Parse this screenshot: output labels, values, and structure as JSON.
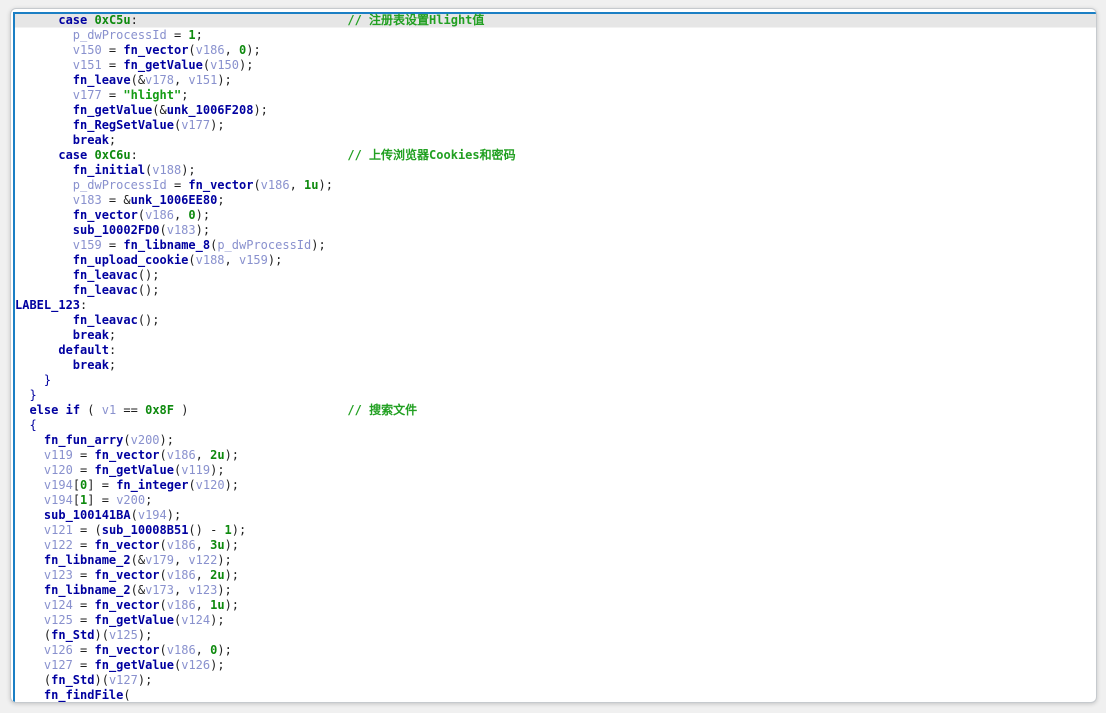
{
  "panel": {
    "type": "pseudocode-decompiler-view"
  },
  "colors": {
    "accent_blue": "#1B7FC4",
    "band_gray": "#E6E6E6",
    "keyword_navy": "#0000A0",
    "variable_periwinkle": "#8991CE",
    "number_green": "#0E8A0E",
    "string_green": "#149C14",
    "comment_green": "#22A022",
    "punct_black": "#1E1E1E",
    "panel_border": "#C6CACE",
    "page_bg": "#F0F0F0"
  },
  "code": {
    "comment_prefix": "// ",
    "comment_column": 46,
    "lines": [
      {
        "highlight": true,
        "comment": "注册表设置Hlight值",
        "segments": [
          [
            "p",
            "      "
          ],
          [
            "kw",
            "case"
          ],
          [
            "p",
            " "
          ],
          [
            "num",
            "0xC5u"
          ],
          [
            "p",
            ":"
          ]
        ]
      },
      {
        "segments": [
          [
            "p",
            "        "
          ],
          [
            "var",
            "p_dwProcessId"
          ],
          [
            "p",
            " = "
          ],
          [
            "num",
            "1"
          ],
          [
            "p",
            ";"
          ]
        ]
      },
      {
        "segments": [
          [
            "p",
            "        "
          ],
          [
            "var",
            "v150"
          ],
          [
            "p",
            " = "
          ],
          [
            "fn",
            "fn_vector"
          ],
          [
            "p",
            "("
          ],
          [
            "var",
            "v186"
          ],
          [
            "p",
            ", "
          ],
          [
            "num",
            "0"
          ],
          [
            "p",
            ");"
          ]
        ]
      },
      {
        "segments": [
          [
            "p",
            "        "
          ],
          [
            "var",
            "v151"
          ],
          [
            "p",
            " = "
          ],
          [
            "fn",
            "fn_getValue"
          ],
          [
            "p",
            "("
          ],
          [
            "var",
            "v150"
          ],
          [
            "p",
            ");"
          ]
        ]
      },
      {
        "segments": [
          [
            "p",
            "        "
          ],
          [
            "fn",
            "fn_leave"
          ],
          [
            "p",
            "(&"
          ],
          [
            "var",
            "v178"
          ],
          [
            "p",
            ", "
          ],
          [
            "var",
            "v151"
          ],
          [
            "p",
            ");"
          ]
        ]
      },
      {
        "segments": [
          [
            "p",
            "        "
          ],
          [
            "var",
            "v177"
          ],
          [
            "p",
            " = "
          ],
          [
            "str",
            "\"hlight\""
          ],
          [
            "p",
            ";"
          ]
        ]
      },
      {
        "segments": [
          [
            "p",
            "        "
          ],
          [
            "fn",
            "fn_getValue"
          ],
          [
            "p",
            "(&"
          ],
          [
            "fn",
            "unk_1006F208"
          ],
          [
            "p",
            ");"
          ]
        ]
      },
      {
        "segments": [
          [
            "p",
            "        "
          ],
          [
            "fn",
            "fn_RegSetValue"
          ],
          [
            "p",
            "("
          ],
          [
            "var",
            "v177"
          ],
          [
            "p",
            ");"
          ]
        ]
      },
      {
        "segments": [
          [
            "p",
            "        "
          ],
          [
            "kw",
            "break"
          ],
          [
            "p",
            ";"
          ]
        ]
      },
      {
        "comment": "上传浏览器Cookies和密码",
        "segments": [
          [
            "p",
            "      "
          ],
          [
            "kw",
            "case"
          ],
          [
            "p",
            " "
          ],
          [
            "num",
            "0xC6u"
          ],
          [
            "p",
            ":"
          ]
        ]
      },
      {
        "segments": [
          [
            "p",
            "        "
          ],
          [
            "fn",
            "fn_initial"
          ],
          [
            "p",
            "("
          ],
          [
            "var",
            "v188"
          ],
          [
            "p",
            ");"
          ]
        ]
      },
      {
        "segments": [
          [
            "p",
            "        "
          ],
          [
            "var",
            "p_dwProcessId"
          ],
          [
            "p",
            " = "
          ],
          [
            "fn",
            "fn_vector"
          ],
          [
            "p",
            "("
          ],
          [
            "var",
            "v186"
          ],
          [
            "p",
            ", "
          ],
          [
            "num",
            "1u"
          ],
          [
            "p",
            ");"
          ]
        ]
      },
      {
        "segments": [
          [
            "p",
            "        "
          ],
          [
            "var",
            "v183"
          ],
          [
            "p",
            " = &"
          ],
          [
            "fn",
            "unk_1006EE80"
          ],
          [
            "p",
            ";"
          ]
        ]
      },
      {
        "segments": [
          [
            "p",
            "        "
          ],
          [
            "fn",
            "fn_vector"
          ],
          [
            "p",
            "("
          ],
          [
            "var",
            "v186"
          ],
          [
            "p",
            ", "
          ],
          [
            "num",
            "0"
          ],
          [
            "p",
            ");"
          ]
        ]
      },
      {
        "segments": [
          [
            "p",
            "        "
          ],
          [
            "fn",
            "sub_10002FD0"
          ],
          [
            "p",
            "("
          ],
          [
            "var",
            "v183"
          ],
          [
            "p",
            ");"
          ]
        ]
      },
      {
        "segments": [
          [
            "p",
            "        "
          ],
          [
            "var",
            "v159"
          ],
          [
            "p",
            " = "
          ],
          [
            "fn",
            "fn_libname_8"
          ],
          [
            "p",
            "("
          ],
          [
            "var",
            "p_dwProcessId"
          ],
          [
            "p",
            ");"
          ]
        ]
      },
      {
        "segments": [
          [
            "p",
            "        "
          ],
          [
            "fn",
            "fn_upload_cookie"
          ],
          [
            "p",
            "("
          ],
          [
            "var",
            "v188"
          ],
          [
            "p",
            ", "
          ],
          [
            "var",
            "v159"
          ],
          [
            "p",
            ");"
          ]
        ]
      },
      {
        "segments": [
          [
            "p",
            "        "
          ],
          [
            "fn",
            "fn_leavac"
          ],
          [
            "p",
            "();"
          ]
        ]
      },
      {
        "segments": [
          [
            "p",
            "        "
          ],
          [
            "fn",
            "fn_leavac"
          ],
          [
            "p",
            "();"
          ]
        ]
      },
      {
        "segments": [
          [
            "fn",
            "LABEL_123"
          ],
          [
            "p",
            ":"
          ]
        ]
      },
      {
        "segments": [
          [
            "p",
            "        "
          ],
          [
            "fn",
            "fn_leavac"
          ],
          [
            "p",
            "();"
          ]
        ]
      },
      {
        "segments": [
          [
            "p",
            "        "
          ],
          [
            "kw",
            "break"
          ],
          [
            "p",
            ";"
          ]
        ]
      },
      {
        "segments": [
          [
            "p",
            "      "
          ],
          [
            "kw",
            "default"
          ],
          [
            "p",
            ":"
          ]
        ]
      },
      {
        "segments": [
          [
            "p",
            "        "
          ],
          [
            "kw",
            "break"
          ],
          [
            "p",
            ";"
          ]
        ]
      },
      {
        "segments": [
          [
            "p",
            "    "
          ],
          [
            "br",
            "}"
          ]
        ]
      },
      {
        "segments": [
          [
            "p",
            "  "
          ],
          [
            "br",
            "}"
          ]
        ]
      },
      {
        "comment": "搜索文件",
        "segments": [
          [
            "p",
            "  "
          ],
          [
            "kw",
            "else"
          ],
          [
            "p",
            " "
          ],
          [
            "kw",
            "if"
          ],
          [
            "p",
            " ( "
          ],
          [
            "var",
            "v1"
          ],
          [
            "p",
            " == "
          ],
          [
            "num",
            "0x8F"
          ],
          [
            "p",
            " )"
          ]
        ]
      },
      {
        "segments": [
          [
            "p",
            "  "
          ],
          [
            "br",
            "{"
          ]
        ]
      },
      {
        "segments": [
          [
            "p",
            "    "
          ],
          [
            "fn",
            "fn_fun_arry"
          ],
          [
            "p",
            "("
          ],
          [
            "var",
            "v200"
          ],
          [
            "p",
            ");"
          ]
        ]
      },
      {
        "segments": [
          [
            "p",
            "    "
          ],
          [
            "var",
            "v119"
          ],
          [
            "p",
            " = "
          ],
          [
            "fn",
            "fn_vector"
          ],
          [
            "p",
            "("
          ],
          [
            "var",
            "v186"
          ],
          [
            "p",
            ", "
          ],
          [
            "num",
            "2u"
          ],
          [
            "p",
            ");"
          ]
        ]
      },
      {
        "segments": [
          [
            "p",
            "    "
          ],
          [
            "var",
            "v120"
          ],
          [
            "p",
            " = "
          ],
          [
            "fn",
            "fn_getValue"
          ],
          [
            "p",
            "("
          ],
          [
            "var",
            "v119"
          ],
          [
            "p",
            ");"
          ]
        ]
      },
      {
        "segments": [
          [
            "p",
            "    "
          ],
          [
            "var",
            "v194"
          ],
          [
            "p",
            "["
          ],
          [
            "num",
            "0"
          ],
          [
            "p",
            "] = "
          ],
          [
            "fn",
            "fn_integer"
          ],
          [
            "p",
            "("
          ],
          [
            "var",
            "v120"
          ],
          [
            "p",
            ");"
          ]
        ]
      },
      {
        "segments": [
          [
            "p",
            "    "
          ],
          [
            "var",
            "v194"
          ],
          [
            "p",
            "["
          ],
          [
            "num",
            "1"
          ],
          [
            "p",
            "] = "
          ],
          [
            "var",
            "v200"
          ],
          [
            "p",
            ";"
          ]
        ]
      },
      {
        "segments": [
          [
            "p",
            "    "
          ],
          [
            "fn",
            "sub_100141BA"
          ],
          [
            "p",
            "("
          ],
          [
            "var",
            "v194"
          ],
          [
            "p",
            ");"
          ]
        ]
      },
      {
        "segments": [
          [
            "p",
            "    "
          ],
          [
            "var",
            "v121"
          ],
          [
            "p",
            " = ("
          ],
          [
            "fn",
            "sub_10008B51"
          ],
          [
            "p",
            "() - "
          ],
          [
            "num",
            "1"
          ],
          [
            "p",
            ");"
          ]
        ]
      },
      {
        "segments": [
          [
            "p",
            "    "
          ],
          [
            "var",
            "v122"
          ],
          [
            "p",
            " = "
          ],
          [
            "fn",
            "fn_vector"
          ],
          [
            "p",
            "("
          ],
          [
            "var",
            "v186"
          ],
          [
            "p",
            ", "
          ],
          [
            "num",
            "3u"
          ],
          [
            "p",
            ");"
          ]
        ]
      },
      {
        "segments": [
          [
            "p",
            "    "
          ],
          [
            "fn",
            "fn_libname_2"
          ],
          [
            "p",
            "(&"
          ],
          [
            "var",
            "v179"
          ],
          [
            "p",
            ", "
          ],
          [
            "var",
            "v122"
          ],
          [
            "p",
            ");"
          ]
        ]
      },
      {
        "segments": [
          [
            "p",
            "    "
          ],
          [
            "var",
            "v123"
          ],
          [
            "p",
            " = "
          ],
          [
            "fn",
            "fn_vector"
          ],
          [
            "p",
            "("
          ],
          [
            "var",
            "v186"
          ],
          [
            "p",
            ", "
          ],
          [
            "num",
            "2u"
          ],
          [
            "p",
            ");"
          ]
        ]
      },
      {
        "segments": [
          [
            "p",
            "    "
          ],
          [
            "fn",
            "fn_libname_2"
          ],
          [
            "p",
            "(&"
          ],
          [
            "var",
            "v173"
          ],
          [
            "p",
            ", "
          ],
          [
            "var",
            "v123"
          ],
          [
            "p",
            ");"
          ]
        ]
      },
      {
        "segments": [
          [
            "p",
            "    "
          ],
          [
            "var",
            "v124"
          ],
          [
            "p",
            " = "
          ],
          [
            "fn",
            "fn_vector"
          ],
          [
            "p",
            "("
          ],
          [
            "var",
            "v186"
          ],
          [
            "p",
            ", "
          ],
          [
            "num",
            "1u"
          ],
          [
            "p",
            ");"
          ]
        ]
      },
      {
        "segments": [
          [
            "p",
            "    "
          ],
          [
            "var",
            "v125"
          ],
          [
            "p",
            " = "
          ],
          [
            "fn",
            "fn_getValue"
          ],
          [
            "p",
            "("
          ],
          [
            "var",
            "v124"
          ],
          [
            "p",
            ");"
          ]
        ]
      },
      {
        "segments": [
          [
            "p",
            "    ("
          ],
          [
            "fn",
            "fn_Std"
          ],
          [
            "p",
            ")("
          ],
          [
            "var",
            "v125"
          ],
          [
            "p",
            ");"
          ]
        ]
      },
      {
        "segments": [
          [
            "p",
            "    "
          ],
          [
            "var",
            "v126"
          ],
          [
            "p",
            " = "
          ],
          [
            "fn",
            "fn_vector"
          ],
          [
            "p",
            "("
          ],
          [
            "var",
            "v186"
          ],
          [
            "p",
            ", "
          ],
          [
            "num",
            "0"
          ],
          [
            "p",
            ");"
          ]
        ]
      },
      {
        "segments": [
          [
            "p",
            "    "
          ],
          [
            "var",
            "v127"
          ],
          [
            "p",
            " = "
          ],
          [
            "fn",
            "fn_getValue"
          ],
          [
            "p",
            "("
          ],
          [
            "var",
            "v126"
          ],
          [
            "p",
            ");"
          ]
        ]
      },
      {
        "segments": [
          [
            "p",
            "    ("
          ],
          [
            "fn",
            "fn_Std"
          ],
          [
            "p",
            ")("
          ],
          [
            "var",
            "v127"
          ],
          [
            "p",
            ");"
          ]
        ]
      },
      {
        "segments": [
          [
            "p",
            "    "
          ],
          [
            "fn",
            "fn_findFile"
          ],
          [
            "p",
            "("
          ]
        ]
      }
    ]
  }
}
